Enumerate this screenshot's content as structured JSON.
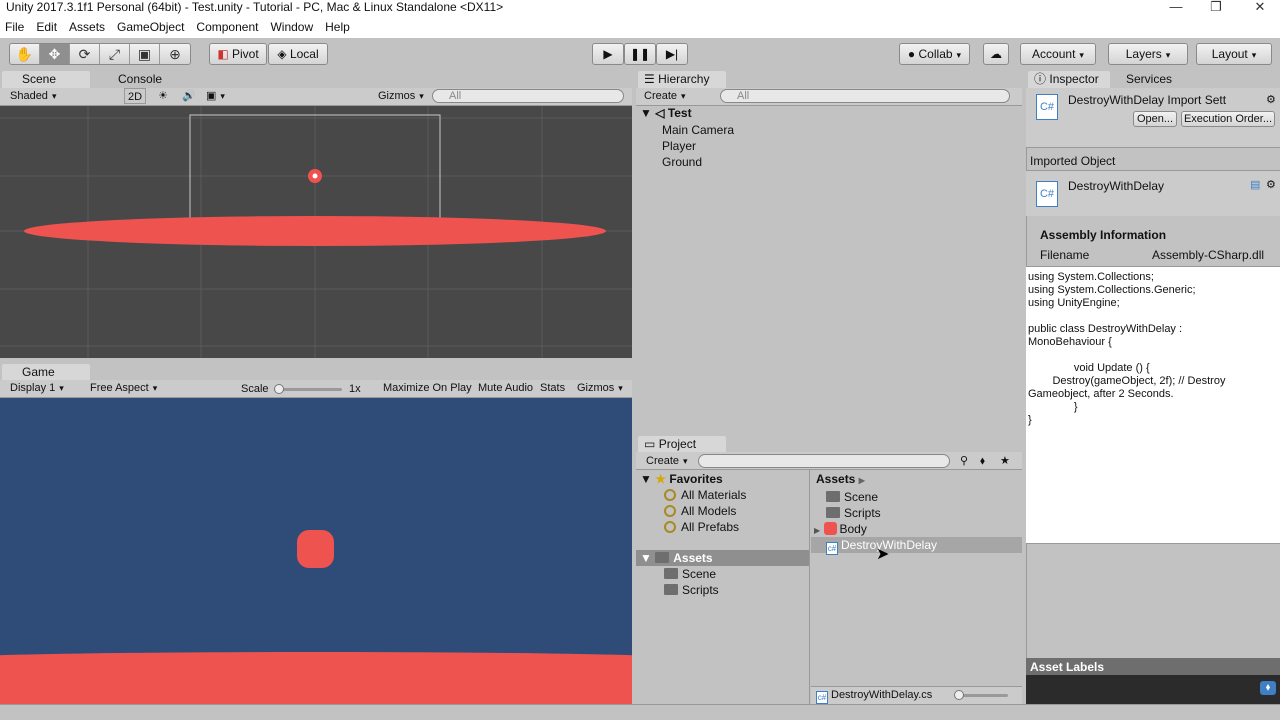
{
  "window": {
    "title": "Unity 2017.3.1f1 Personal (64bit) - Test.unity - Tutorial - PC, Mac & Linux Standalone <DX11>"
  },
  "menu": [
    "File",
    "Edit",
    "Assets",
    "GameObject",
    "Component",
    "Window",
    "Help"
  ],
  "toolbar": {
    "pivot": "Pivot",
    "local": "Local",
    "collab": "Collab",
    "account": "Account",
    "layers": "Layers",
    "layout": "Layout"
  },
  "scene": {
    "tab_scene": "Scene",
    "tab_console": "Console",
    "shading": "Shaded",
    "mode_2d": "2D",
    "gizmos": "Gizmos",
    "search_placeholder": "All"
  },
  "game": {
    "tab": "Game",
    "display": "Display 1",
    "aspect": "Free Aspect",
    "scale_label": "Scale",
    "scale_value": "1x",
    "maximize": "Maximize On Play",
    "mute": "Mute Audio",
    "stats": "Stats",
    "gizmos": "Gizmos"
  },
  "hierarchy": {
    "tab": "Hierarchy",
    "create": "Create",
    "search_placeholder": "All",
    "scene_name": "Test",
    "items": [
      "Main Camera",
      "Player",
      "Ground"
    ]
  },
  "project": {
    "tab": "Project",
    "create": "Create",
    "favorites_label": "Favorites",
    "favorites": [
      "All Materials",
      "All Models",
      "All Prefabs"
    ],
    "assets_label": "Assets",
    "asset_folders": [
      "Scene",
      "Scripts"
    ],
    "breadcrumb": "Assets",
    "asset_items": [
      "Scene",
      "Scripts",
      "Body",
      "DestroyWithDelay"
    ],
    "footer_file": "DestroyWithDelay.cs"
  },
  "inspector": {
    "tab": "Inspector",
    "tab_services": "Services",
    "header_title": "DestroyWithDelay Import Sett",
    "open_button": "Open...",
    "exec_order_button": "Execution Order...",
    "imported_object_label": "Imported Object",
    "object_name": "DestroyWithDelay",
    "assembly_info_label": "Assembly Information",
    "filename_label": "Filename",
    "filename_value": "Assembly-CSharp.dll",
    "code": "using System.Collections;\nusing System.Collections.Generic;\nusing UnityEngine;\n\npublic class DestroyWithDelay :\nMonoBehaviour {\n\n               void Update () {\n        Destroy(gameObject, 2f); // Destroy\nGameobject, after 2 Seconds.\n               }\n}",
    "asset_labels": "Asset Labels"
  },
  "colors": {
    "accent_red": "#ef5350",
    "game_bg": "#2f4b78",
    "scene_bg": "#484848"
  }
}
